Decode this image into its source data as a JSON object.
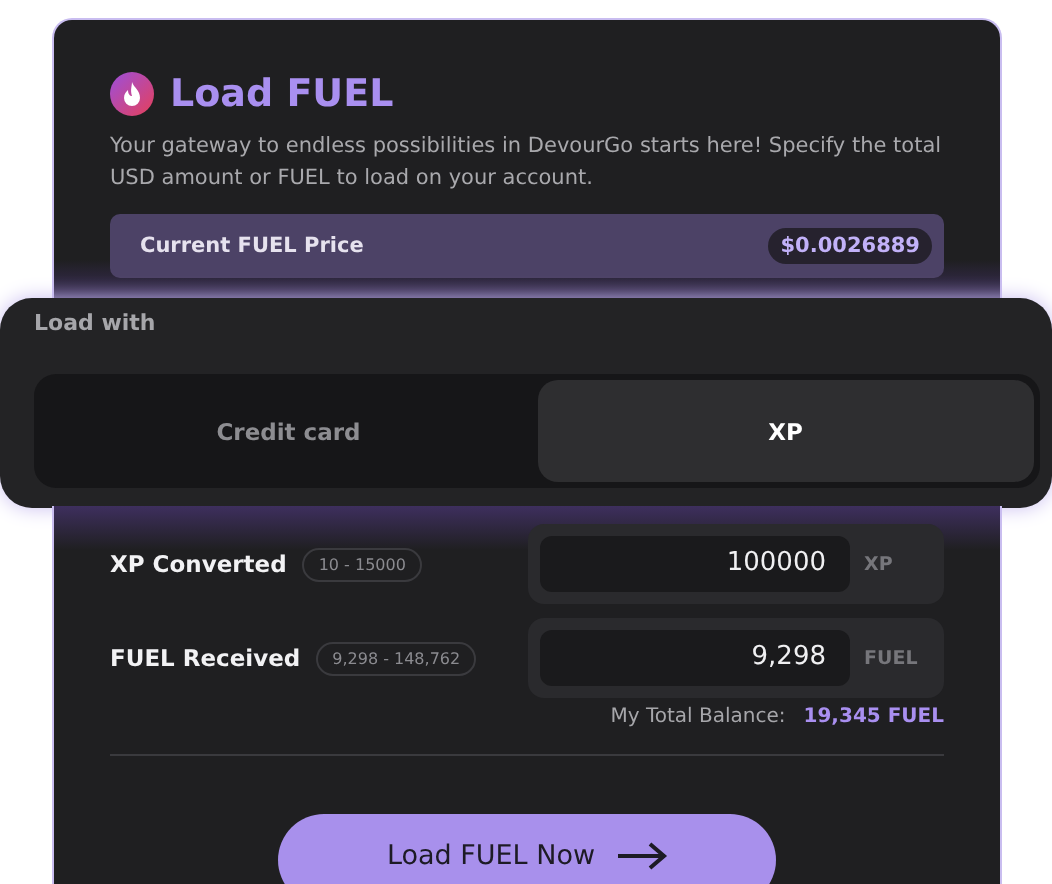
{
  "header": {
    "title": "Load FUEL",
    "description": "Your gateway to endless possibilities in DevourGo starts here! Specify the total USD amount or FUEL to load on your account."
  },
  "price": {
    "label": "Current FUEL Price",
    "value": "$0.0026889"
  },
  "load_with": {
    "label": "Load with",
    "options": [
      {
        "label": "Credit card",
        "selected": false
      },
      {
        "label": "XP",
        "selected": true
      }
    ]
  },
  "fields": [
    {
      "label": "XP Converted",
      "range": "10 - 15000",
      "value": "100000",
      "unit": "XP"
    },
    {
      "label": "FUEL Received",
      "range": "9,298 - 148,762",
      "value": "9,298",
      "unit": "FUEL"
    }
  ],
  "balance": {
    "label": "My Total Balance:",
    "value": "19,345 FUEL"
  },
  "submit": {
    "label": "Load FUEL Now"
  }
}
